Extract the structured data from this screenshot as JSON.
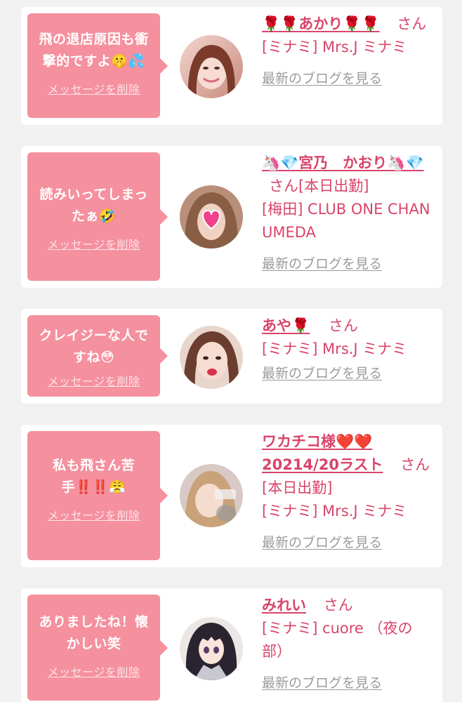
{
  "delete_label": "メッセージを削除",
  "blog_label": "最新のブログを見る",
  "colors": {
    "accent_pink": "#f5909e",
    "name_red": "#d9446a",
    "link_gray": "#9b9b9b",
    "background": "#f1f1f1"
  },
  "entries": [
    {
      "message": "飛の退店原因も衝撃的ですよ🤫💦",
      "name": "🌹🌹あかり🌹🌹",
      "honorific": "さん",
      "status": "",
      "shop": "[ミナミ] Mrs.J ミナミ",
      "avatar": "woman-photo"
    },
    {
      "message": "読みいってしまったぁ🤣",
      "name": "🦄💎宮乃　かおり🦄💎",
      "honorific": "さん",
      "status": "[本日出勤]",
      "shop": "[梅田] CLUB ONE CHAN UMEDA",
      "avatar": "woman-photo-heart-sticker"
    },
    {
      "message": "クレイジーな人ですね😳",
      "name": "あや🌹",
      "honorific": "さん",
      "status": "",
      "shop": "[ミナミ] Mrs.J ミナミ",
      "avatar": "woman-photo"
    },
    {
      "message": "私も飛さん苦手‼️‼️😤",
      "name": "ワカチコ様❤️❤️20214/20ラスト",
      "honorific": "さん",
      "status": "[本日出勤]",
      "shop": "[ミナミ] Mrs.J ミナミ",
      "avatar": "woman-photo-2021"
    },
    {
      "message": "ありましたね！懐かしい笑",
      "name": "みれい",
      "honorific": "さん",
      "status": "",
      "shop": "[ミナミ] cuore （夜の部）",
      "avatar": "anime-character"
    }
  ]
}
